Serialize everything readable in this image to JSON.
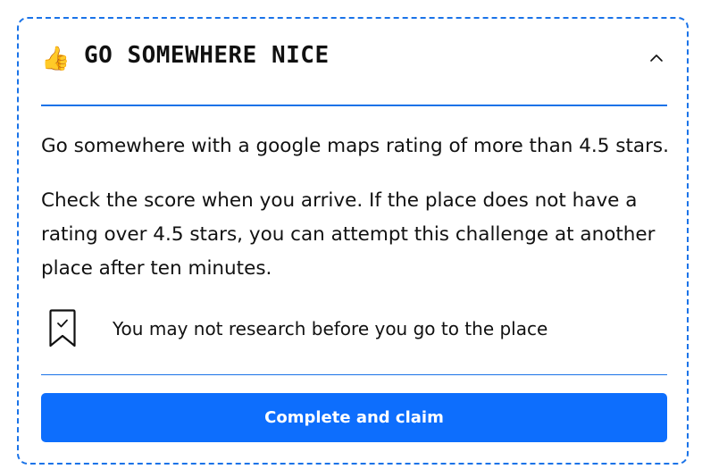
{
  "challenge": {
    "emoji": "👍",
    "emoji_icon": "thumbs-up-icon",
    "title": "GO SOMEWHERE NICE",
    "collapse_icon": "chevron-up-icon",
    "description": "Go somewhere with a google maps rating of more than 4.5 stars.",
    "details": "Check the score when you arrive. If the place does not have a rating over 4.5 stars, you can attempt this challenge at another place after ten minutes.",
    "rule": {
      "icon": "bookmark-check-icon",
      "text": "You may not research before you go to the place"
    },
    "action_label": "Complete and claim"
  },
  "colors": {
    "accent": "#1a73e8",
    "button": "#0d6efd",
    "text": "#111111",
    "background": "#ffffff"
  }
}
